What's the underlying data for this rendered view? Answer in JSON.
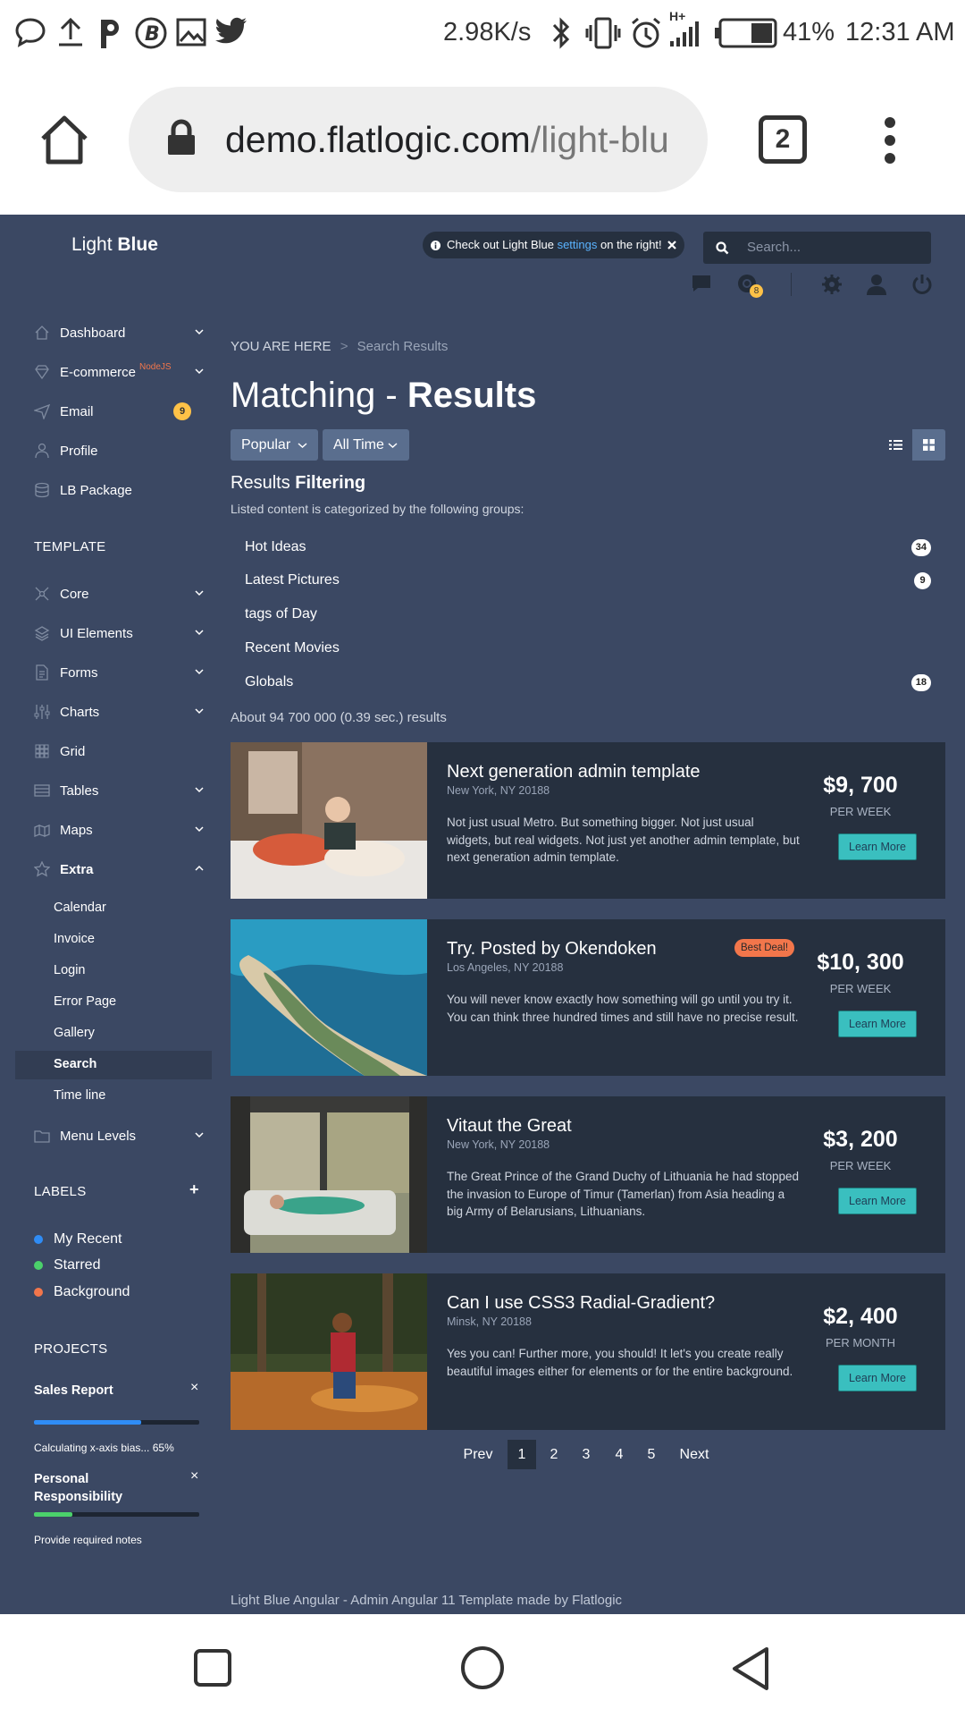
{
  "status": {
    "speed": "2.98K/s",
    "battery": "41%",
    "time": "12:31 AM",
    "network": "H+"
  },
  "browser": {
    "url_domain": "demo.flatlogic.com",
    "url_path": "/light-blu",
    "tabs": "2"
  },
  "app": {
    "brand_light": "Light ",
    "brand_bold": "Blue",
    "banner_pre": "Check out Light Blue ",
    "banner_link": "settings",
    "banner_post": " on the right!",
    "search_placeholder": "Search...",
    "notif_count": "8"
  },
  "sidebar": {
    "items": [
      {
        "label": "Dashboard"
      },
      {
        "label": "E-commerce",
        "sup": "NodeJS"
      },
      {
        "label": "Email",
        "badge": "9"
      },
      {
        "label": "Profile"
      },
      {
        "label": "LB Package"
      }
    ],
    "template_title": "TEMPLATE",
    "template_items": [
      {
        "label": "Core"
      },
      {
        "label": "UI Elements"
      },
      {
        "label": "Forms"
      },
      {
        "label": "Charts"
      },
      {
        "label": "Grid"
      },
      {
        "label": "Tables"
      },
      {
        "label": "Maps"
      },
      {
        "label": "Extra"
      }
    ],
    "extra_sub": [
      "Calendar",
      "Invoice",
      "Login",
      "Error Page",
      "Gallery",
      "Search",
      "Time line"
    ],
    "menu_levels": "Menu Levels",
    "labels_title": "LABELS",
    "labels": [
      {
        "label": "My Recent",
        "color": "#2f8cf5"
      },
      {
        "label": "Starred",
        "color": "#4bd16b"
      },
      {
        "label": "Background",
        "color": "#f2764b"
      }
    ],
    "projects_title": "PROJECTS",
    "projects": [
      {
        "title": "Sales Report",
        "progress": 0.65,
        "note": "Calculating x-axis bias... 65%",
        "color": "#2f8cf5"
      },
      {
        "title": "Personal Responsibility",
        "progress": 0.23,
        "note": "Provide required notes",
        "color": "#4bd16b"
      }
    ]
  },
  "main": {
    "crumb_here": "YOU ARE HERE",
    "crumb_sep": ">",
    "crumb_page": "Search Results",
    "title_light": "Matching - ",
    "title_bold": "Results",
    "filter1": "Popular",
    "filter2": "All Time",
    "filtering_light": "Results ",
    "filtering_bold": "Filtering",
    "filtering_sub": "Listed content is categorized by the following groups:",
    "groups": [
      {
        "label": "Hot Ideas",
        "count": "34"
      },
      {
        "label": "Latest Pictures",
        "count": "9"
      },
      {
        "label": "tags of Day"
      },
      {
        "label": "Recent Movies"
      },
      {
        "label": "Globals",
        "count": "18"
      }
    ],
    "results_count": "About 94 700 000 (0.39 sec.) results",
    "results": [
      {
        "title": "Next generation admin template",
        "location": "New York, NY 20188",
        "desc": "Not just usual Metro. But something bigger. Not just usual widgets, but real widgets. Not just yet another admin template, but next generation admin template.",
        "price": "$9, 700",
        "period": "PER WEEK",
        "button": "Learn More"
      },
      {
        "title": "Try. Posted by Okendoken",
        "badge": "Best Deal!",
        "location": "Los Angeles, NY 20188",
        "desc": "You will never know exactly how something will go until you try it. You can think three hundred times and still have no precise result.",
        "price": "$10, 300",
        "period": "PER WEEK",
        "button": "Learn More"
      },
      {
        "title": "Vitaut the Great",
        "location": "New York, NY 20188",
        "desc": "The Great Prince of the Grand Duchy of Lithuania he had stopped the invasion to Europe of Timur (Tamerlan) from Asia heading a big Army of Belarusians, Lithuanians.",
        "price": "$3, 200",
        "period": "PER WEEK",
        "button": "Learn More"
      },
      {
        "title": "Can I use CSS3 Radial-Gradient?",
        "location": "Minsk, NY 20188",
        "desc": "Yes you can! Further more, you should! It let's you create really beautiful images either for elements or for the entire background.",
        "price": "$2, 400",
        "period": "PER MONTH",
        "button": "Learn More"
      }
    ],
    "pagination": {
      "prev": "Prev",
      "pages": [
        "1",
        "2",
        "3",
        "4",
        "5"
      ],
      "next": "Next",
      "active": "1"
    },
    "footer": "Light Blue Angular - Admin Angular 11 Template made by Flatlogic"
  }
}
